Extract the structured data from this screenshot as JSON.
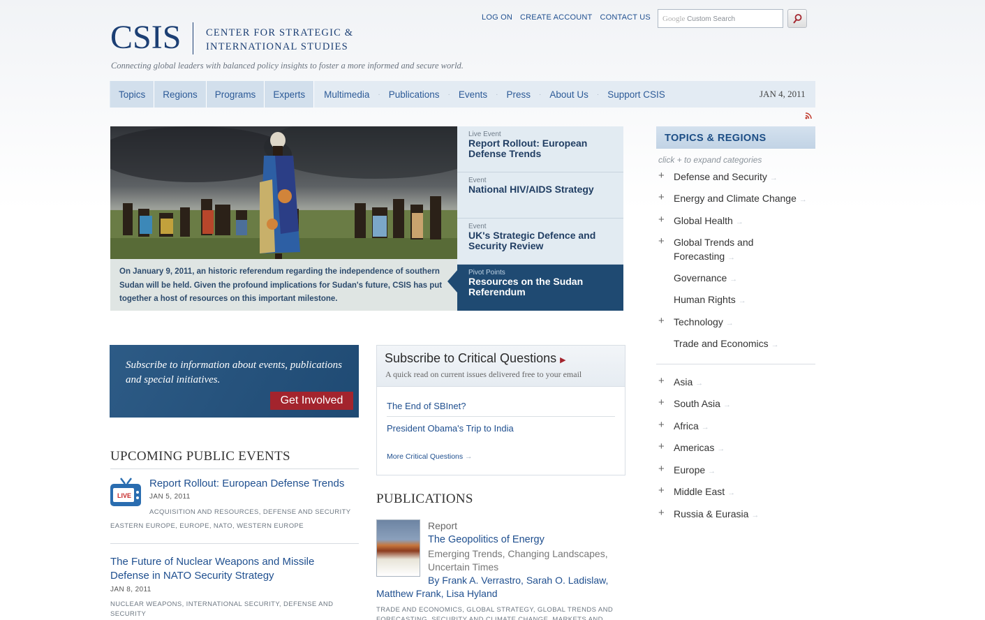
{
  "header": {
    "logo": "CSIS",
    "full_name_line1": "CENTER FOR STRATEGIC &",
    "full_name_line2": "INTERNATIONAL STUDIES",
    "tagline": "Connecting global leaders with balanced policy insights to foster a more informed and secure world.",
    "top_links": [
      "LOG ON",
      "CREATE ACCOUNT",
      "CONTACT US"
    ],
    "search_placeholder_brand": "Google",
    "search_placeholder": "Custom Search"
  },
  "nav": {
    "items": [
      "Topics",
      "Regions",
      "Programs",
      "Experts",
      "Multimedia",
      "Publications",
      "Events",
      "Press",
      "About Us",
      "Support CSIS"
    ],
    "date": "JAN 4, 2011"
  },
  "feature": {
    "caption": "On January 9, 2011, an historic referendum regarding the independence of southern Sudan will be held. Given the profound implications for Sudan's future, CSIS has put together a host of resources on this important milestone.",
    "items": [
      {
        "kind": "Live Event",
        "title": "Report Rollout: European Defense Trends"
      },
      {
        "kind": "Event",
        "title": "National HIV/AIDS Strategy"
      },
      {
        "kind": "Event",
        "title": "UK's Strategic Defence and Security Review"
      },
      {
        "kind": "Pivot Points",
        "title": "Resources on the Sudan Referendum"
      }
    ]
  },
  "sidebar": {
    "heading": "TOPICS & REGIONS",
    "hint": "click + to expand categories",
    "topics": [
      {
        "label": "Defense and Security",
        "expandable": true
      },
      {
        "label": "Energy and Climate Change",
        "expandable": true
      },
      {
        "label": "Global Health",
        "expandable": true
      },
      {
        "label": "Global Trends and Forecasting",
        "expandable": true
      },
      {
        "label": "Governance",
        "expandable": false
      },
      {
        "label": "Human Rights",
        "expandable": false
      },
      {
        "label": "Technology",
        "expandable": true
      },
      {
        "label": "Trade and Economics",
        "expandable": false
      }
    ],
    "regions": [
      "Asia",
      "South Asia",
      "Africa",
      "Americas",
      "Europe",
      "Middle East",
      "Russia & Eurasia"
    ]
  },
  "get_involved": {
    "text": "Subscribe to information about events, publications and special initiatives.",
    "button": "Get Involved"
  },
  "critical_questions": {
    "title": "Subscribe to Critical Questions",
    "subtitle": "A quick read on current issues delivered free to your email",
    "links": [
      "The End of SBInet?",
      "President Obama's Trip to India"
    ],
    "more": "More Critical Questions"
  },
  "events": {
    "heading": "UPCOMING PUBLIC EVENTS",
    "live_badge": "LIVE",
    "items": [
      {
        "title": "Report Rollout: European Defense Trends",
        "date": "JAN 5, 2011",
        "tags_line1": "ACQUISITION AND RESOURCES, DEFENSE AND SECURITY",
        "tags_line2": "EASTERN EUROPE, EUROPE, NATO, WESTERN EUROPE"
      },
      {
        "title": "The Future of Nuclear Weapons and Missile Defense in NATO Security Strategy",
        "date": "JAN 8, 2011",
        "tags_line1": "NUCLEAR WEAPONS, INTERNATIONAL SECURITY, DEFENSE AND",
        "tags_line2": "SECURITY"
      }
    ]
  },
  "publications": {
    "heading": "PUBLICATIONS",
    "item": {
      "kind": "Report",
      "title": "The Geopolitics of Energy",
      "subtitle_line1": "Emerging Trends, Changing Landscapes,",
      "subtitle_line2": "Uncertain Times",
      "by": "By",
      "authors_line1": "Frank A. Verrastro, Sarah O. Ladislaw,",
      "authors_line2": "Matthew Frank, Lisa Hyland",
      "tags_line1": "TRADE AND ECONOMICS, GLOBAL STRATEGY, GLOBAL TRENDS AND",
      "tags_line2": "FORECASTING, SECURITY AND CLIMATE CHANGE, MARKETS AND"
    }
  },
  "colors": {
    "brand_blue": "#1c3f74",
    "link_blue": "#1f4f8f",
    "active_feature": "#1f4a72",
    "cta_red": "#a3242d"
  }
}
